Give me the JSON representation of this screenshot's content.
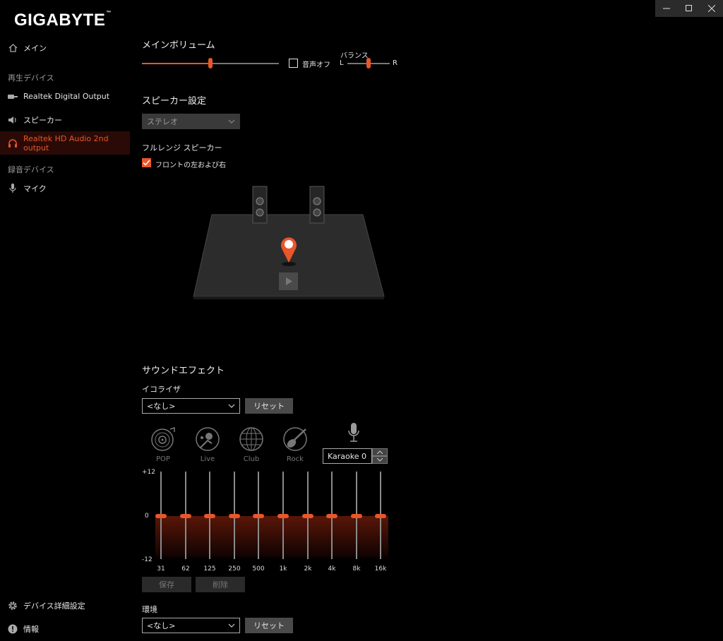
{
  "app": {
    "logo": "GIGABYTE"
  },
  "sidebar": {
    "main_label": "メイン",
    "playback_section": "再生デバイス",
    "playback_items": [
      {
        "label": "Realtek Digital Output"
      },
      {
        "label": "スピーカー"
      },
      {
        "label": "Realtek HD Audio 2nd output"
      }
    ],
    "record_section": "録音デバイス",
    "record_items": [
      {
        "label": "マイク"
      }
    ],
    "advanced_label": "デバイス詳細設定",
    "info_label": "情報"
  },
  "volume": {
    "title": "メインボリューム",
    "level": 0.5,
    "mute_label": "音声オフ",
    "mute_checked": false,
    "balance_label": "バランス",
    "balance_left": "L",
    "balance_right": "R",
    "balance_value": 0.5
  },
  "speaker": {
    "title": "スピーカー設定",
    "config_value": "ステレオ",
    "fullrange_title": "フルレンジ スピーカー",
    "front_lr_label": "フロントの左および右",
    "front_lr_checked": true
  },
  "sound_effect": {
    "title": "サウンドエフェクト",
    "equalizer_label": "イコライザ",
    "eq_preset_value": "<なし>",
    "reset_label": "リセット",
    "presets": [
      {
        "label": "POP"
      },
      {
        "label": "Live"
      },
      {
        "label": "Club"
      },
      {
        "label": "Rock"
      }
    ],
    "karaoke_value": "Karaoke 0",
    "eq_scale": {
      "max": "+12",
      "mid": "0",
      "min": "-12"
    },
    "bands": [
      {
        "freq": "31",
        "gain": 0
      },
      {
        "freq": "62",
        "gain": 0
      },
      {
        "freq": "125",
        "gain": 0
      },
      {
        "freq": "250",
        "gain": 0
      },
      {
        "freq": "500",
        "gain": 0
      },
      {
        "freq": "1k",
        "gain": 0
      },
      {
        "freq": "2k",
        "gain": 0
      },
      {
        "freq": "4k",
        "gain": 0
      },
      {
        "freq": "8k",
        "gain": 0
      },
      {
        "freq": "16k",
        "gain": 0
      }
    ],
    "save_label": "保存",
    "delete_label": "削除"
  },
  "environment": {
    "title": "環境",
    "value": "<なし>",
    "reset_label": "リセット"
  },
  "colors": {
    "accent": "#e8562a"
  }
}
